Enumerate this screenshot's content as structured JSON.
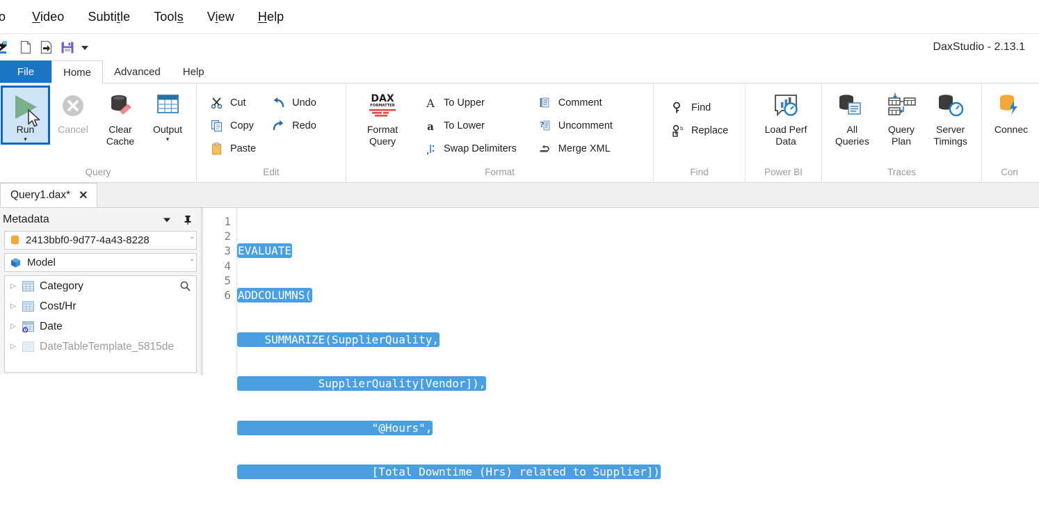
{
  "host_menu": {
    "items": [
      {
        "pre": "",
        "accel": "",
        "post": "o"
      },
      {
        "pre": "",
        "accel": "V",
        "post": "ideo"
      },
      {
        "pre": "Subti",
        "accel": "t",
        "post": "le"
      },
      {
        "pre": "Tool",
        "accel": "s",
        "post": ""
      },
      {
        "pre": "V",
        "accel": "i",
        "post": "ew"
      },
      {
        "pre": "",
        "accel": "H",
        "post": "elp"
      }
    ]
  },
  "quick_access": {
    "icons": [
      "app-logo-icon",
      "new-file-icon",
      "open-file-icon",
      "save-icon",
      "customize-qat-caret-icon"
    ]
  },
  "app": {
    "title": "DaxStudio - 2.13.1"
  },
  "ribbon": {
    "tabs": [
      {
        "label": "File",
        "style": "file"
      },
      {
        "label": "Home",
        "style": "active"
      },
      {
        "label": "Advanced",
        "style": "normal"
      },
      {
        "label": "Help",
        "style": "normal"
      }
    ],
    "groups": [
      {
        "name": "query",
        "label": "Query",
        "buttons": [
          {
            "name": "run-button",
            "label": "Run",
            "icon": "play-triangle-icon",
            "state": "selected",
            "caret": "▾"
          },
          {
            "name": "cancel-button",
            "label": "Cancel",
            "icon": "cancel-circle-icon",
            "state": "disabled",
            "caret": ""
          },
          {
            "name": "clear-cache-button",
            "label": "Clear\nCache",
            "icon": "clear-cache-icon",
            "state": "normal",
            "caret": ""
          },
          {
            "name": "output-button",
            "label": "Output",
            "icon": "output-grid-icon",
            "state": "normal",
            "caret": "▾"
          }
        ]
      },
      {
        "name": "edit",
        "label": "Edit",
        "columns": [
          [
            {
              "name": "cut-button",
              "label": "Cut",
              "icon": "scissors-icon"
            },
            {
              "name": "copy-button",
              "label": "Copy",
              "icon": "copy-icon"
            },
            {
              "name": "paste-button",
              "label": "Paste",
              "icon": "clipboard-icon"
            }
          ],
          [
            {
              "name": "undo-button",
              "label": "Undo",
              "icon": "undo-arrow-icon"
            },
            {
              "name": "redo-button",
              "label": "Redo",
              "icon": "redo-arrow-icon"
            }
          ]
        ]
      },
      {
        "name": "format",
        "label": "Format",
        "big": [
          {
            "name": "format-query-button",
            "label": "Format\nQuery",
            "icon": "dax-formatter-icon",
            "caret": "▾"
          }
        ],
        "columns": [
          [
            {
              "name": "to-upper-button",
              "label": "To Upper",
              "icon": "uppercase-a-icon"
            },
            {
              "name": "to-lower-button",
              "label": "To Lower",
              "icon": "lowercase-a-icon"
            },
            {
              "name": "swap-delimiters-button",
              "label": "Swap Delimiters",
              "icon": "swap-delimiters-icon"
            }
          ],
          [
            {
              "name": "comment-button",
              "label": "Comment",
              "icon": "comment-icon"
            },
            {
              "name": "uncomment-button",
              "label": "Uncomment",
              "icon": "uncomment-icon"
            },
            {
              "name": "merge-xml-button",
              "label": "Merge XML",
              "icon": "merge-xml-icon"
            }
          ]
        ]
      },
      {
        "name": "find",
        "label": "Find",
        "columns": [
          [
            {
              "name": "find-button",
              "label": "Find",
              "icon": "magnifier-key-icon"
            },
            {
              "name": "replace-button",
              "label": "Replace",
              "icon": "replace-icon"
            }
          ]
        ]
      },
      {
        "name": "power-bi",
        "label": "Power BI",
        "buttons": [
          {
            "name": "load-perf-data-button",
            "label": "Load Perf\nData",
            "icon": "load-perf-data-icon",
            "state": "normal",
            "caret": ""
          }
        ]
      },
      {
        "name": "traces",
        "label": "Traces",
        "buttons": [
          {
            "name": "all-queries-button",
            "label": "All\nQueries",
            "icon": "all-queries-icon",
            "state": "normal",
            "caret": ""
          },
          {
            "name": "query-plan-button",
            "label": "Query\nPlan",
            "icon": "query-plan-icon",
            "state": "normal",
            "caret": ""
          },
          {
            "name": "server-timings-button",
            "label": "Server\nTimings",
            "icon": "server-timings-icon",
            "state": "normal",
            "caret": ""
          }
        ]
      },
      {
        "name": "connection",
        "label": "Con",
        "buttons": [
          {
            "name": "connect-button",
            "label": "Connec",
            "icon": "connect-icon",
            "state": "normal",
            "caret": ""
          }
        ]
      }
    ]
  },
  "document_tabs": [
    {
      "label": "Query1.dax*",
      "close": "✕",
      "active": true
    }
  ],
  "metadata": {
    "title": "Metadata",
    "header_icons": [
      "chevron-down-icon",
      "pin-icon"
    ],
    "connection": {
      "value": "2413bbf0-9d77-4a43-8228",
      "icon": "database-orange-icon",
      "caret": "ˇ"
    },
    "model": {
      "value": "Model",
      "icon": "model-cube-icon",
      "caret": "ˇ"
    },
    "search_icon": "search-icon",
    "tree": [
      {
        "label": "Category",
        "icon": "table-icon",
        "expander": "▷",
        "dim": false,
        "badge": ""
      },
      {
        "label": "Cost/Hr",
        "icon": "table-icon",
        "expander": "▷",
        "dim": false,
        "badge": ""
      },
      {
        "label": "Date",
        "icon": "table-icon",
        "expander": "▷",
        "dim": false,
        "badge": "date-table-clock-icon"
      },
      {
        "label": "DateTableTemplate_5815de",
        "icon": "table-icon",
        "expander": "▷",
        "dim": true,
        "badge": ""
      }
    ]
  },
  "editor": {
    "line_numbers": [
      "1",
      "2",
      "3",
      "4",
      "5",
      "6"
    ],
    "lines": [
      "EVALUATE",
      "ADDCOLUMNS(",
      "    SUMMARIZE(SupplierQuality,",
      "            SupplierQuality[Vendor]),",
      "                    \"@Hours\",",
      "                    [Total Downtime (Hrs) related to Supplier])"
    ],
    "selection_color": "#4a9fe0",
    "all_selected": true
  },
  "colors": {
    "file_tab_blue": "#1b74c4",
    "selection_blue": "#4a9fe0",
    "run_highlight_border": "#0a68c4",
    "run_highlight_fill": "#cfe4f7",
    "accent_orange": "#f2a83b"
  }
}
